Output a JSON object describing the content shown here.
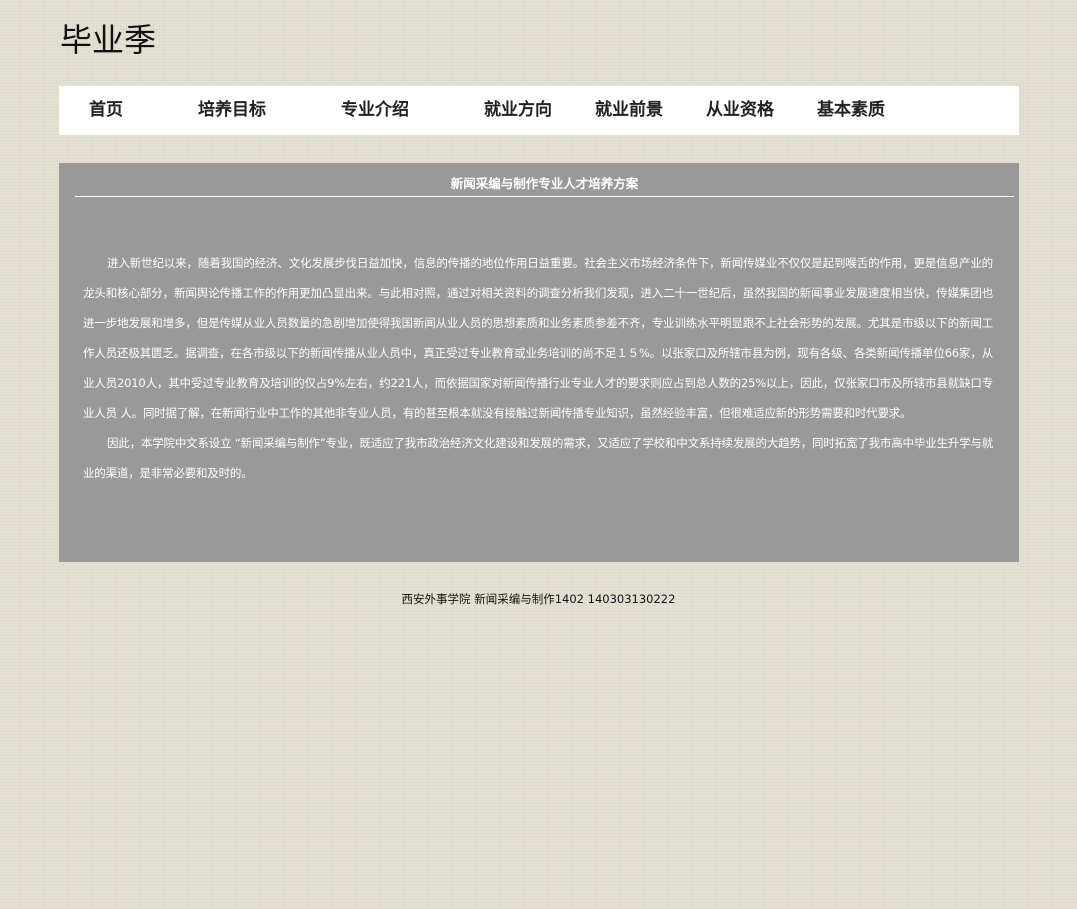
{
  "site": {
    "title": "毕业季"
  },
  "nav": {
    "items": [
      {
        "label": "首页"
      },
      {
        "label": "培养目标"
      },
      {
        "label": "专业介绍"
      },
      {
        "label": "就业方向"
      },
      {
        "label": "就业前景"
      },
      {
        "label": "从业资格"
      },
      {
        "label": "基本素质"
      }
    ]
  },
  "article": {
    "title": "新闻采编与制作专业人才培养方案",
    "paragraphs": [
      "进入新世纪以来，随着我国的经济、文化发展步伐日益加快，信息的传播的地位作用日益重要。社会主义市场经济条件下，新闻传媒业不仅仅是起到喉舌的作用，更是信息产业的龙头和核心部分，新闻舆论传播工作的作用更加凸显出来。与此相对照，通过对相关资料的调查分析我们发现，进入二十一世纪后，虽然我国的新闻事业发展速度相当快，传媒集团也进一步地发展和增多，但是传媒从业人员数量的急剧增加使得我国新闻从业人员的思想素质和业务素质参差不齐，专业训练水平明显跟不上社会形势的发展。尤其是市级以下的新闻工作人员还极其匮乏。据调查，在各市级以下的新闻传播从业人员中，真正受过专业教育或业务培训的尚不足１５%。以张家口及所辖市县为例，现有各级、各类新闻传播单位66家，从业人员2010人，其中受过专业教育及培训的仅占9%左右，约221人，而依据国家对新闻传播行业专业人才的要求则应占到总人数的25%以上，因此，仅张家口市及所辖市县就缺口专业人员 人。同时据了解，在新闻行业中工作的其他非专业人员，有的甚至根本就没有接触过新闻传播专业知识，虽然经验丰富，但很难适应新的形势需要和时代要求。",
      "因此，本学院中文系设立 “新闻采编与制作”专业，既适应了我市政治经济文化建设和发展的需求，又适应了学校和中文系持续发展的大趋势，同时拓宽了我市高中毕业生升学与就业的渠道，是非常必要和及时的。"
    ]
  },
  "footer": {
    "text": "西安外事学院 新闻采编与制作1402 140303130222"
  }
}
